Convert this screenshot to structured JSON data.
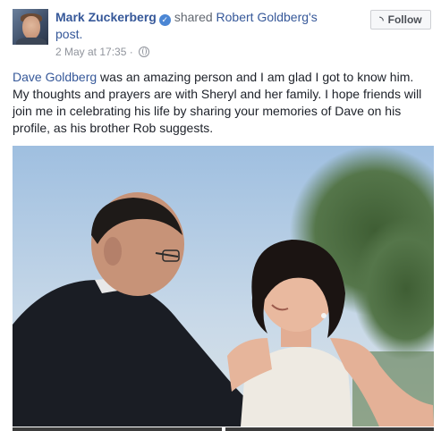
{
  "post": {
    "author": "Mark Zuckerberg",
    "action_prefix": "shared ",
    "shared_owner": "Robert Goldberg's",
    "shared_object": "post.",
    "timestamp": "2 May at 17:35 ·",
    "follow_label": "Follow",
    "text_link": "Dave Goldberg",
    "text_rest": " was an amazing person and I am glad I got to know him. My thoughts and prayers are with Sheryl and her family. I hope friends will join me in celebrating his life by sharing your memories of Dave on his profile, as his brother Rob suggests."
  },
  "icons": {
    "verified": "verified-badge-icon",
    "audience": "globe-icon",
    "follow": "rss-icon"
  },
  "colors": {
    "link": "#365899",
    "meta": "#90949c",
    "verified": "#4b86d4"
  }
}
